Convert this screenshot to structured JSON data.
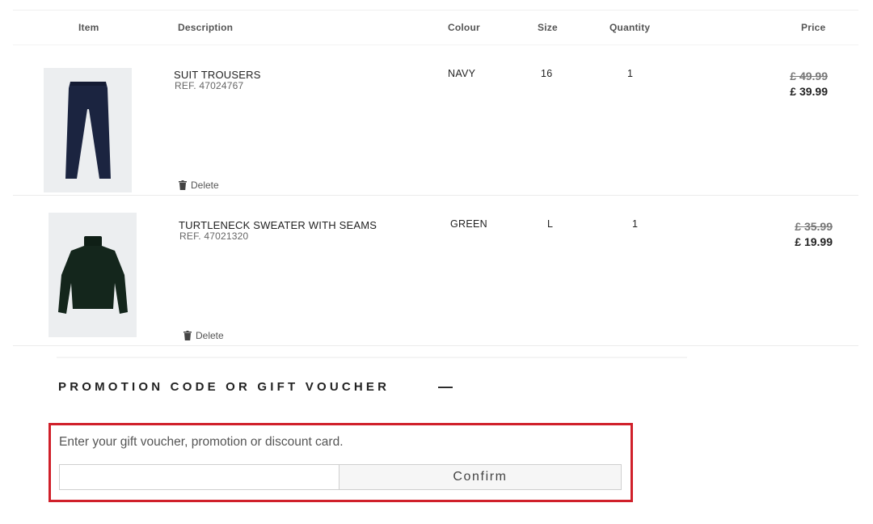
{
  "table": {
    "headers": {
      "item": "Item",
      "description": "Description",
      "colour": "Colour",
      "size": "Size",
      "quantity": "Quantity",
      "price": "Price"
    },
    "rows": [
      {
        "image_icon": "trousers-image",
        "name": "SUIT TROUSERS",
        "ref": "REF. 47024767",
        "colour": "NAVY",
        "size": "16",
        "quantity": "1",
        "old_price": "£ 49.99",
        "new_price": "£ 39.99",
        "delete_label": "Delete"
      },
      {
        "image_icon": "sweater-image",
        "name": "TURTLENECK SWEATER WITH SEAMS",
        "ref": "REF. 47021320",
        "colour": "GREEN",
        "size": "L",
        "quantity": "1",
        "old_price": "£ 35.99",
        "new_price": "£ 19.99",
        "delete_label": "Delete"
      }
    ]
  },
  "promo": {
    "title": "PROMOTION CODE OR GIFT VOUCHER",
    "toggle_symbol": "—",
    "hint": "Enter your gift voucher, promotion or discount card.",
    "input_value": "",
    "confirm_label": "Confirm",
    "highlight_color": "#d0202a"
  }
}
